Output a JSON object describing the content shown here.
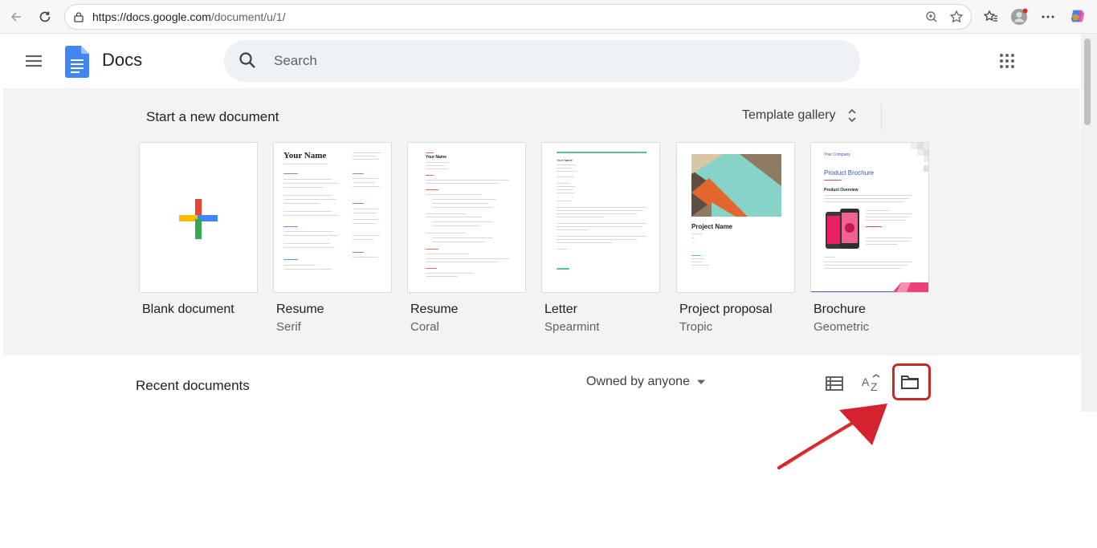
{
  "browser": {
    "url_host": "https://docs.google.com",
    "url_path": "/document/u/1/"
  },
  "header": {
    "app_title": "Docs",
    "search_placeholder": "Search"
  },
  "templates": {
    "section_title": "Start a new document",
    "gallery_label": "Template gallery",
    "items": [
      {
        "name": "Blank document",
        "subtitle": ""
      },
      {
        "name": "Resume",
        "subtitle": "Serif"
      },
      {
        "name": "Resume",
        "subtitle": "Coral"
      },
      {
        "name": "Letter",
        "subtitle": "Spearmint"
      },
      {
        "name": "Project proposal",
        "subtitle": "Tropic"
      },
      {
        "name": "Brochure",
        "subtitle": "Geometric"
      }
    ],
    "thumb_text": {
      "serif_title": "Your Name",
      "coral_title": "Your Name",
      "letter_name": "Your Name",
      "tropic_title": "Project Name",
      "brochure_company": "Your Company",
      "brochure_title": "Product Brochure",
      "brochure_section": "Product Overview"
    }
  },
  "recent": {
    "title": "Recent documents",
    "owner_filter": "Owned by anyone"
  },
  "colors": {
    "accent_blue": "#4285f4",
    "red": "#ea4335",
    "yellow": "#fbbc04",
    "green": "#34a853",
    "highlight": "#c62828"
  }
}
